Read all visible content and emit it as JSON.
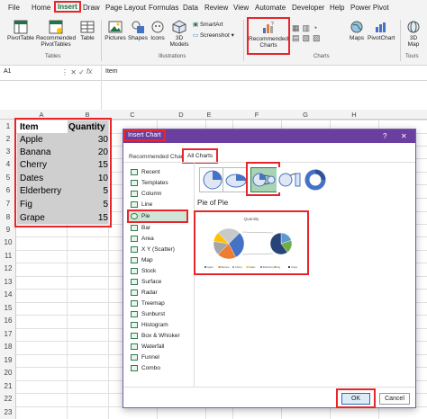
{
  "ribbon": {
    "tabs": [
      "File",
      "Home",
      "Insert",
      "Draw",
      "Page Layout",
      "Formulas",
      "Data",
      "Review",
      "View",
      "Automate",
      "Developer",
      "Help",
      "Power Pivot"
    ],
    "buttons": {
      "pivottable": "PivotTable",
      "rec_pivot": "Recommended PivotTables",
      "table": "Table",
      "pictures": "Pictures",
      "shapes": "Shapes",
      "icons": "Icons",
      "models": "3D Models",
      "smartart": "SmartArt",
      "screenshot": "Screenshot",
      "rec_charts": "Recommended Charts",
      "maps": "Maps",
      "pivotchart": "PivotChart",
      "threed": "3D Map"
    },
    "groups": {
      "tables": "Tables",
      "illustrations": "Illustrations",
      "charts": "Charts",
      "tours": "Tours"
    }
  },
  "formula_bar": {
    "name_box": "A1",
    "fx": "fx",
    "content": "Item"
  },
  "sheet": {
    "columns": [
      "A",
      "B",
      "C",
      "D",
      "E",
      "F",
      "G",
      "H"
    ],
    "rows": [
      "1",
      "2",
      "3",
      "4",
      "5",
      "6",
      "7",
      "8",
      "9",
      "10",
      "11",
      "12",
      "13",
      "14",
      "15",
      "16",
      "17",
      "18",
      "19",
      "20",
      "21",
      "22",
      "23"
    ],
    "headers": {
      "item": "Item",
      "quantity": "Quantity"
    },
    "data": [
      {
        "item": "Apple",
        "qty": "30"
      },
      {
        "item": "Banana",
        "qty": "20"
      },
      {
        "item": "Cherry",
        "qty": "15"
      },
      {
        "item": "Dates",
        "qty": "10"
      },
      {
        "item": "Elderberry",
        "qty": "5"
      },
      {
        "item": "Fig",
        "qty": "5"
      },
      {
        "item": "Grape",
        "qty": "15"
      }
    ]
  },
  "dialog": {
    "title": "Insert Chart",
    "help": "?",
    "close": "✕",
    "tab_recommended": "Recommended Charts",
    "tab_all": "All Charts",
    "chart_types": [
      "Recent",
      "Templates",
      "Column",
      "Line",
      "Pie",
      "Bar",
      "Area",
      "X Y (Scatter)",
      "Map",
      "Stock",
      "Surface",
      "Radar",
      "Treemap",
      "Sunburst",
      "Histogram",
      "Box & Whisker",
      "Waterfall",
      "Funnel",
      "Combo"
    ],
    "selected_type": "Pie",
    "subtype_title": "Pie of Pie",
    "preview_title": "Quantity",
    "legend": [
      "Apple",
      "Banana",
      "Cherry",
      "Dates",
      "Elderberry",
      "Fig",
      "Grape"
    ],
    "ok": "OK",
    "cancel": "Cancel"
  },
  "colors": {
    "accent_red": "#e8252b",
    "excel_green": "#217346",
    "dialog_purple": "#6b3fa0",
    "pie": [
      "#4472c4",
      "#ed7d31",
      "#a5a5a5",
      "#ffc000",
      "#5b9bd5",
      "#70ad47",
      "#264478"
    ]
  },
  "pie_data": [
    30,
    20,
    15,
    10,
    5,
    5,
    15
  ]
}
